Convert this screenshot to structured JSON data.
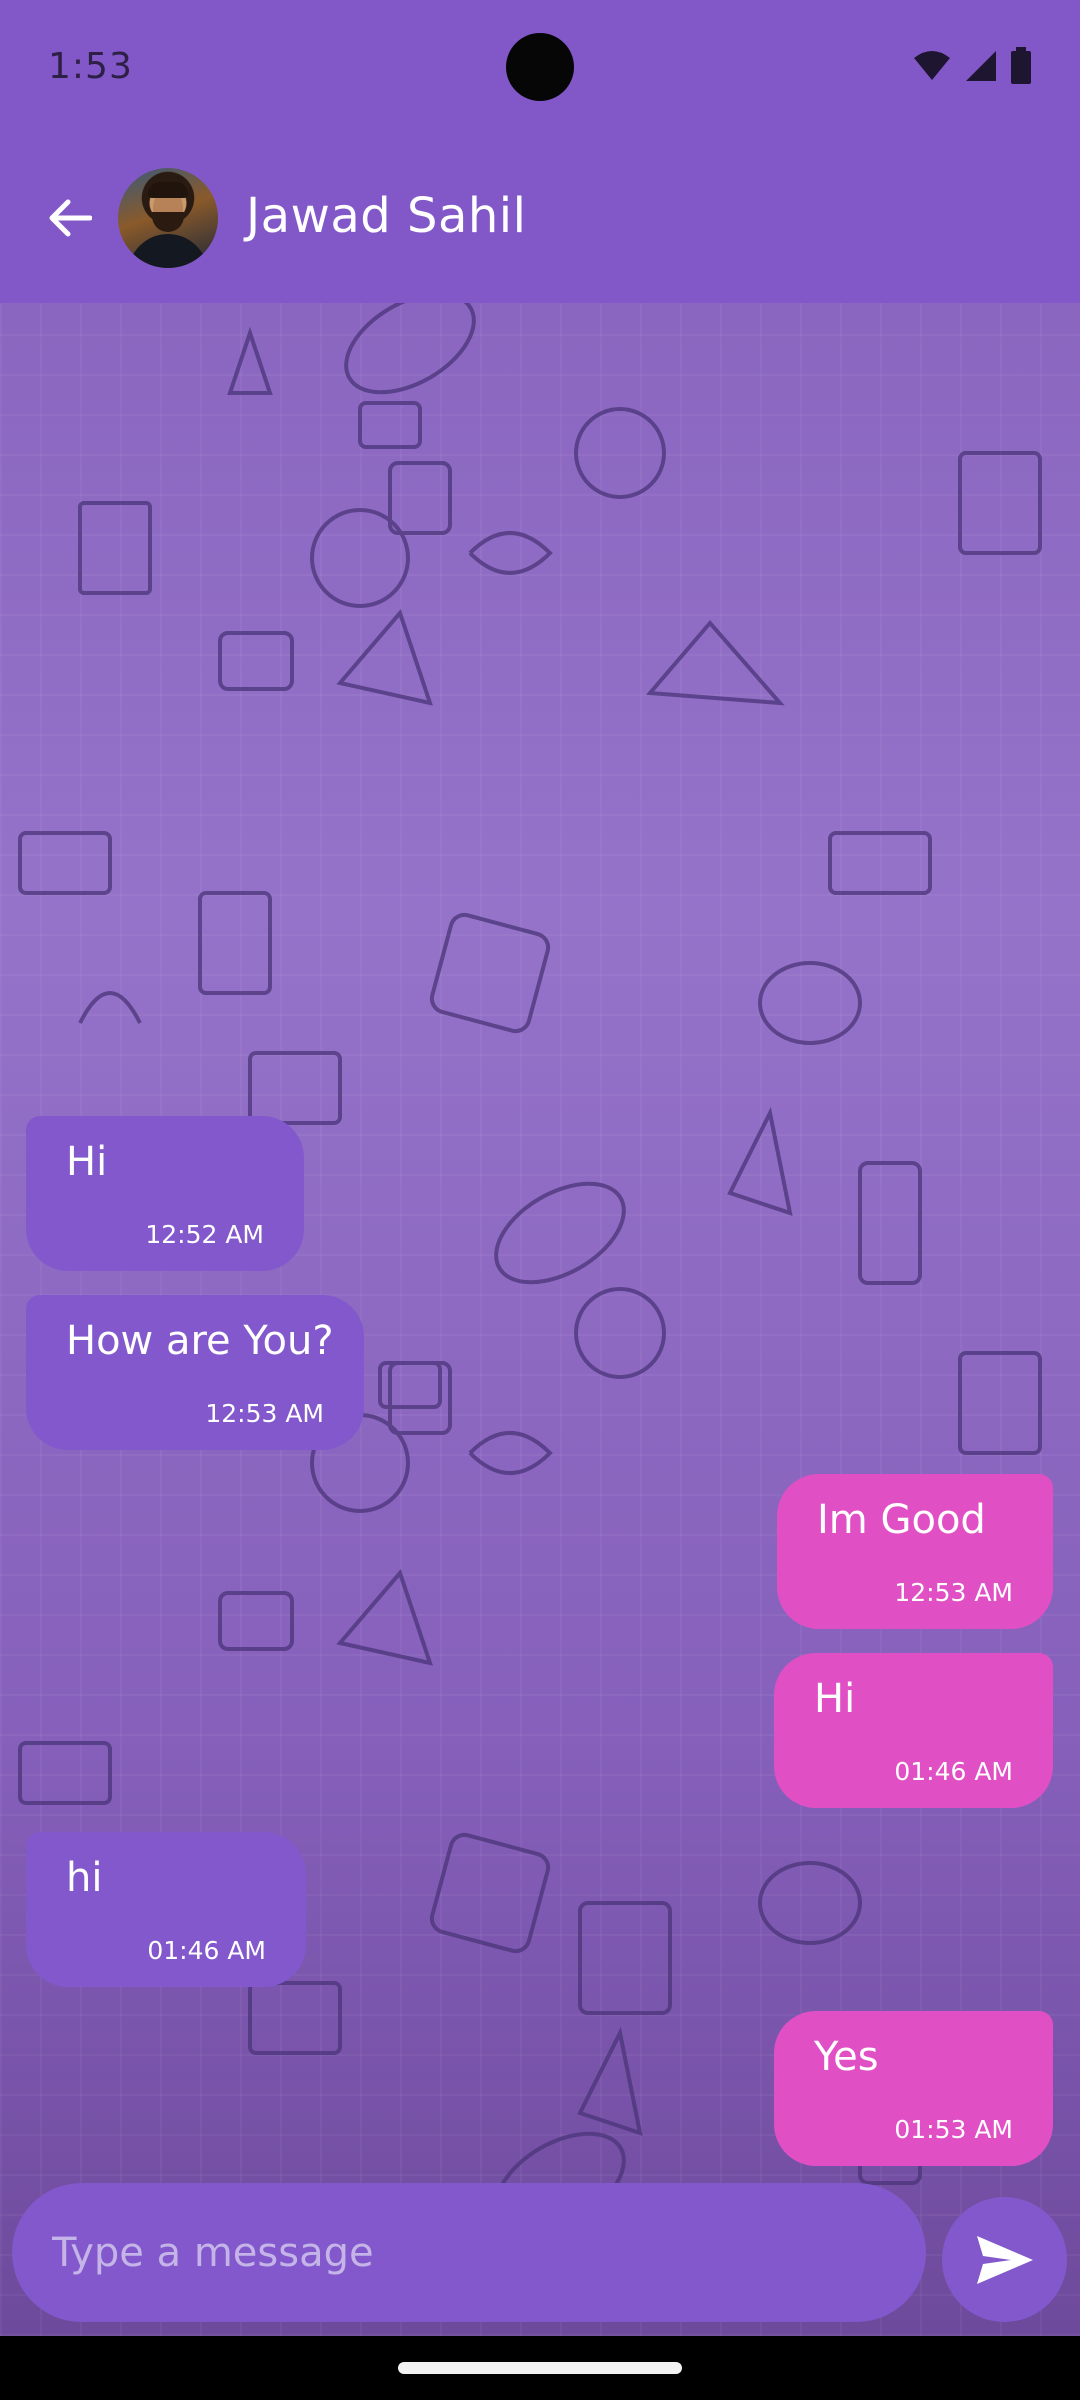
{
  "status_bar": {
    "time": "1:53",
    "icons": [
      "wifi-icon",
      "signal-icon",
      "battery-icon"
    ]
  },
  "header": {
    "back_icon": "arrow-left-icon",
    "contact_name": "Jawad Sahil"
  },
  "messages": [
    {
      "direction": "incoming",
      "text": "Hi",
      "time": "12:52 AM"
    },
    {
      "direction": "incoming",
      "text": "How are You?",
      "time": "12:53 AM"
    },
    {
      "direction": "outgoing",
      "text": "Im Good",
      "time": "12:53 AM"
    },
    {
      "direction": "outgoing",
      "text": "Hi",
      "time": "01:46 AM"
    },
    {
      "direction": "incoming",
      "text": "hi",
      "time": "01:46 AM"
    },
    {
      "direction": "outgoing",
      "text": "Yes",
      "time": "01:53 AM"
    }
  ],
  "composer": {
    "placeholder": "Type a message",
    "send_icon": "send-icon"
  },
  "colors": {
    "header": "#8258c9",
    "incoming_bubble": "#8258cc",
    "outgoing_bubble": "#e050c4",
    "chat_background": "#8a66c0"
  }
}
